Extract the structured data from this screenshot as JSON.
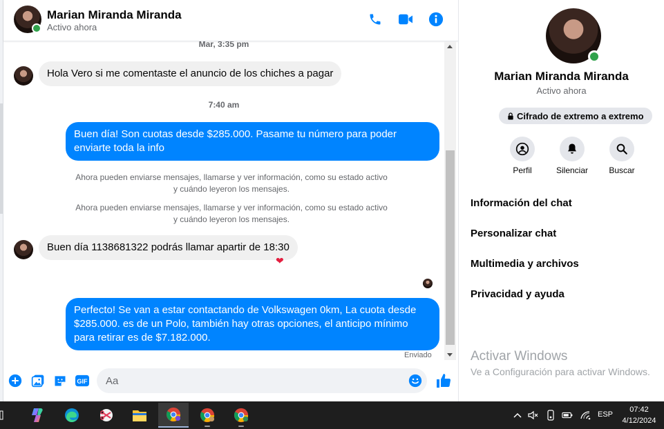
{
  "header": {
    "name": "Marian Miranda Miranda",
    "status": "Activo ahora"
  },
  "messages": {
    "ts1": "Mar, 3:35 pm",
    "m1": "Hola Vero si me comentaste el anuncio de los chiches a pagar",
    "ts2": "7:40 am",
    "m2": "Buen día! Son cuotas desde $285.000. Pasame tu número para poder enviarte toda la info",
    "sys1": "Ahora pueden enviarse mensajes, llamarse y ver información, como su estado activo y cuándo leyeron los mensajes.",
    "sys2": "Ahora pueden enviarse mensajes, llamarse y ver información, como su estado activo y cuándo leyeron los mensajes.",
    "m3": "Buen día 1138681322 podrás llamar apartir de 18:30",
    "m3_reaction": "❤",
    "m4": "Perfecto!  Se van a estar contactando de Volkswagen 0km, La cuota desde $285.000. es de un Polo, también hay otras opciones, el anticipo mínimo para retirar es de $7.182.000.",
    "sent_label": "Enviado"
  },
  "composer": {
    "placeholder": "Aa"
  },
  "panel": {
    "name": "Marian Miranda Miranda",
    "status": "Activo ahora",
    "encryption": "Cifrado de extremo a extremo",
    "actions": [
      "Perfil",
      "Silenciar",
      "Buscar"
    ],
    "menu": [
      "Información del chat",
      "Personalizar chat",
      "Multimedia y archivos",
      "Privacidad y ayuda"
    ]
  },
  "watermark": {
    "title": "Activar Windows",
    "subtitle": "Ve a Configuración para activar Windows."
  },
  "taskbar": {
    "lang": "ESP",
    "time": "07:42",
    "date": "4/12/2024"
  },
  "colors": {
    "accent": "#0084ff",
    "online": "#31a24c"
  }
}
